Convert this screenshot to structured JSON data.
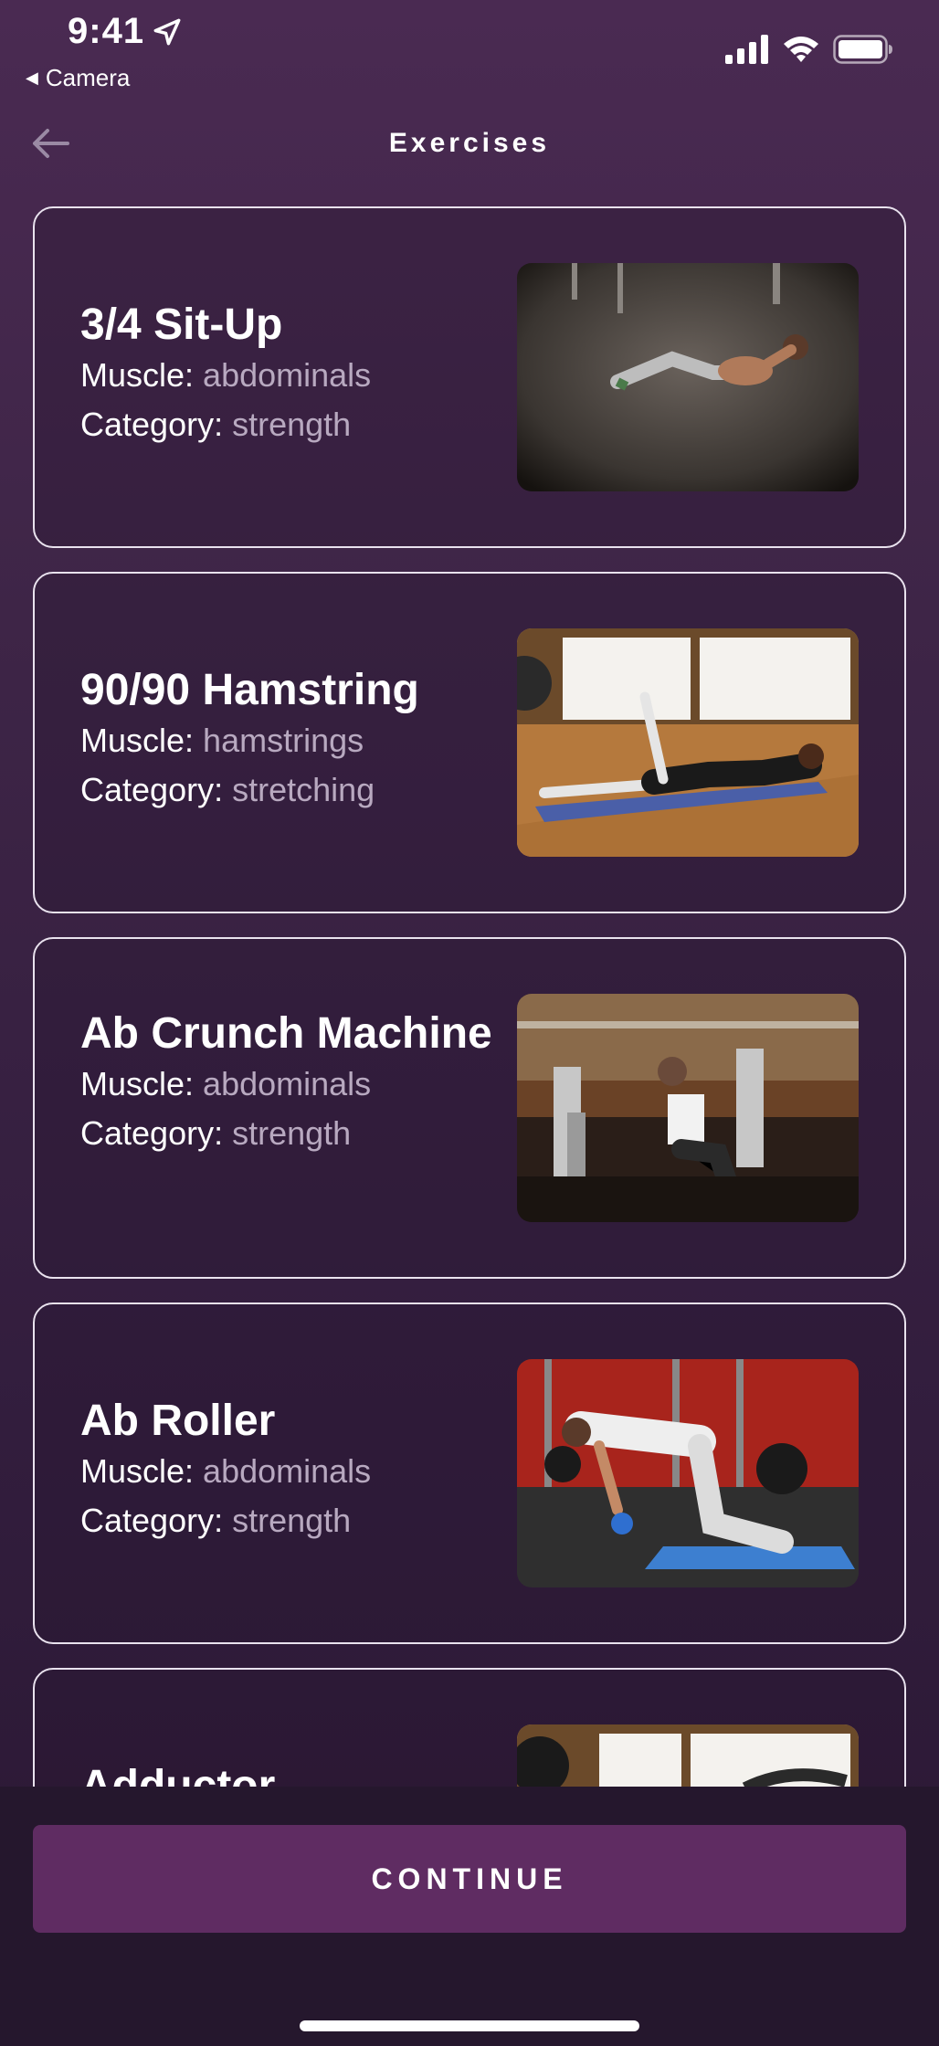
{
  "status_bar": {
    "time": "9:41",
    "back_app": "Camera",
    "location_icon": "location-arrow-icon",
    "signal_icon": "cellular-signal-icon",
    "wifi_icon": "wifi-icon",
    "battery_icon": "battery-icon"
  },
  "nav": {
    "title": "Exercises",
    "back_icon": "arrow-left-icon"
  },
  "labels": {
    "muscle": "Muscle: ",
    "category": "Category: "
  },
  "exercises": [
    {
      "name": "3/4 Sit-Up",
      "muscle": "abdominals",
      "category": "strength"
    },
    {
      "name": "90/90 Hamstring",
      "muscle": "hamstrings",
      "category": "stretching"
    },
    {
      "name": "Ab Crunch Machine",
      "muscle": "abdominals",
      "category": "strength"
    },
    {
      "name": "Ab Roller",
      "muscle": "abdominals",
      "category": "strength"
    },
    {
      "name": "Adductor",
      "muscle": "",
      "category": ""
    }
  ],
  "footer": {
    "continue_label": "CONTINUE"
  },
  "colors": {
    "background": "#3e2547",
    "card_border": "#e9e2ee",
    "meta_value": "#b8a9c0",
    "button": "#5f2c62"
  }
}
